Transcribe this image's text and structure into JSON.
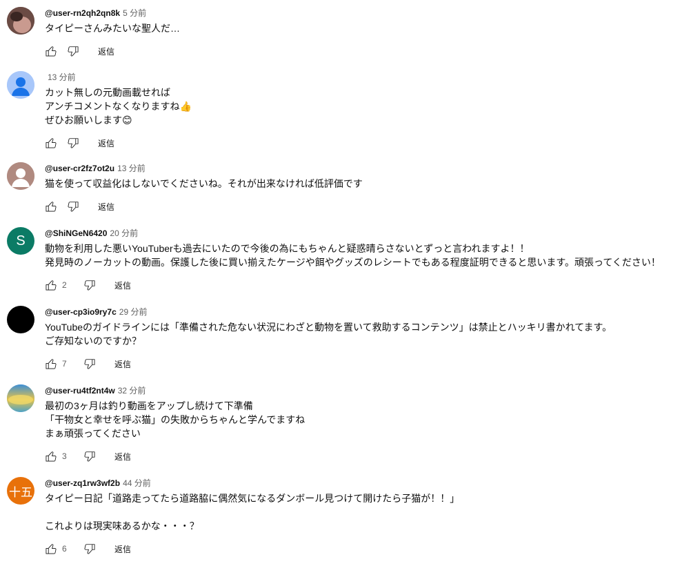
{
  "comments": [
    {
      "author": "@user-rn2qh2qn8k",
      "time": "5 分前",
      "lines": [
        "タイピーさんみたいな聖人だ…"
      ],
      "likes": "",
      "reply": "返信",
      "avatar": {
        "type": "photo",
        "colors": [
          "#6b4b44",
          "#c99a8f"
        ]
      }
    },
    {
      "author": "",
      "time": "13 分前",
      "lines": [
        "カット無しの元動画載せれば",
        "アンチコメントなくなりますね👍",
        "ぜひお願いします😊"
      ],
      "likes": "",
      "reply": "返信",
      "avatar": {
        "type": "default",
        "colors": [
          "#a8c7fa",
          "#1a73e8"
        ]
      }
    },
    {
      "author": "@user-cr2fz7ot2u",
      "time": "13 分前",
      "lines": [
        "猫を使って収益化はしないでくださいね。それが出来なければ低評価です"
      ],
      "likes": "",
      "reply": "返信",
      "avatar": {
        "type": "default",
        "colors": [
          "#b08a80",
          "#ffffff"
        ]
      }
    },
    {
      "author": "@ShiNGeN6420",
      "time": "20 分前",
      "lines": [
        "動物を利用した悪いYouTuberも過去にいたので今後の為にもちゃんと疑惑晴らさないとずっと言われますよ！！",
        "発見時のノーカットの動画。保護した後に買い揃えたケージや餌やグッズのレシートでもある程度証明できると思います。頑張ってください！"
      ],
      "likes": "2",
      "reply": "返信",
      "avatar": {
        "type": "letter",
        "letter": "S",
        "colors": [
          "#0b7b65",
          "#ffffff"
        ]
      }
    },
    {
      "author": "@user-cp3io9ry7c",
      "time": "29 分前",
      "lines": [
        "YouTubeのガイドラインには「準備された危ない状況にわざと動物を置いて救助するコンテンツ」は禁止とハッキリ書かれてます。",
        "ご存知ないのですか？"
      ],
      "likes": "7",
      "reply": "返信",
      "avatar": {
        "type": "solid",
        "colors": [
          "#000000",
          "#000000"
        ]
      }
    },
    {
      "author": "@user-ru4tf2nt4w",
      "time": "32 分前",
      "lines": [
        "最初の3ヶ月は釣り動画をアップし続けて下準備",
        "「干物女と幸せを呼ぶ猫」の失敗からちゃんと学んでますね",
        "まぁ頑張ってください"
      ],
      "likes": "3",
      "reply": "返信",
      "avatar": {
        "type": "gradient",
        "colors": [
          "#3d8fd6",
          "#e7c347"
        ]
      }
    },
    {
      "author": "@user-zq1rw3wf2b",
      "time": "44 分前",
      "lines": [
        "タイピー日記「道路走ってたら道路脇に偶然気になるダンボール見つけて開けたら子猫が！！」",
        "",
        "これよりは現実味あるかな・・・？"
      ],
      "likes": "6",
      "reply": "返信",
      "avatar": {
        "type": "letter",
        "letter": "十五",
        "colors": [
          "#e8710a",
          "#ffffff"
        ]
      }
    }
  ]
}
